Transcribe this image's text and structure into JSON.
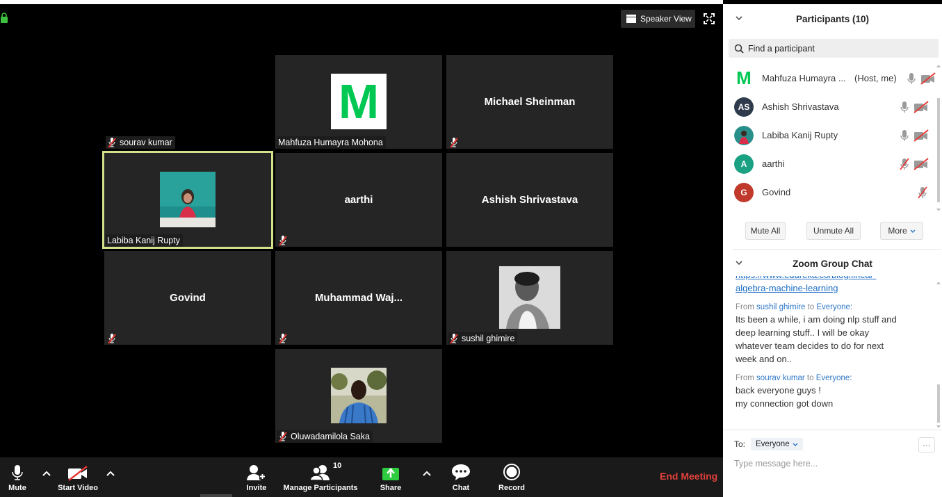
{
  "window": {
    "speaker_view_label": "Speaker View"
  },
  "tiles": [
    {
      "id": "sourav",
      "name": "sourav kumar"
    },
    {
      "id": "mahfuza",
      "name": "Mahfuza Humayra Mohona",
      "avatar_letter": "M"
    },
    {
      "id": "michael",
      "name": "Michael Sheinman"
    },
    {
      "id": "labiba",
      "name": "Labiba Kanij Rupty"
    },
    {
      "id": "aarthi",
      "name": "aarthi"
    },
    {
      "id": "ashish",
      "name": "Ashish Shrivastava"
    },
    {
      "id": "govind",
      "name": "Govind"
    },
    {
      "id": "muhammad",
      "name": "Muhammad  Waj..."
    },
    {
      "id": "sushil",
      "name": "sushil ghimire"
    },
    {
      "id": "oluwadamilola",
      "name": "Oluwadamilola Saka"
    }
  ],
  "toolbar": {
    "mute_label": "Mute",
    "start_video_label": "Start Video",
    "invite_label": "Invite",
    "manage_participants_label": "Manage Participants",
    "participant_count": "10",
    "share_label": "Share",
    "chat_label": "Chat",
    "record_label": "Record",
    "end_meeting_label": "End Meeting"
  },
  "participants_panel": {
    "title": "Participants (10)",
    "search_placeholder": "Find a participant",
    "items": [
      {
        "initials": "M",
        "name": "Mahfuza Humayra ...",
        "tag": "(Host, me)",
        "color": "#00c853"
      },
      {
        "initials": "AS",
        "name": "Ashish Shrivastava",
        "tag": "",
        "color": "#2f3b4c"
      },
      {
        "initials": "",
        "name": "Labiba Kanij Rupty",
        "tag": "",
        "color": "#2a8f8a"
      },
      {
        "initials": "A",
        "name": "aarthi",
        "tag": "",
        "color": "#1aa083"
      },
      {
        "initials": "G",
        "name": "Govind",
        "tag": "",
        "color": "#c0392b"
      }
    ],
    "mute_all_label": "Mute All",
    "unmute_all_label": "Unmute All",
    "more_label": "More"
  },
  "chat_panel": {
    "title": "Zoom Group Chat",
    "link_partial": "https://www.edureka.co/blog/linear-",
    "link_text": "algebra-machine-learning",
    "messages": [
      {
        "from_label": "From",
        "sender": "sushil ghimire",
        "to_label": "to",
        "recipient": "Everyone:",
        "lines": [
          "Its been a while, i am doing nlp stuff and",
          "deep learning stuff.. I will be okay",
          "whatever team decides to do for next",
          "week and on.."
        ]
      },
      {
        "from_label": "From",
        "sender": "sourav kumar",
        "to_label": "to",
        "recipient": "Everyone:",
        "lines": [
          "back everyone guys !",
          "my connection got down"
        ]
      }
    ],
    "to_label": "To:",
    "to_value": "Everyone",
    "more_dots": "···",
    "input_placeholder": "Type message here..."
  },
  "colors": {
    "end_meeting": "#e0403a",
    "active_speaker_border": "#d5e08a",
    "share_green": "#2ecc40",
    "link_blue": "#1a6bc4"
  }
}
